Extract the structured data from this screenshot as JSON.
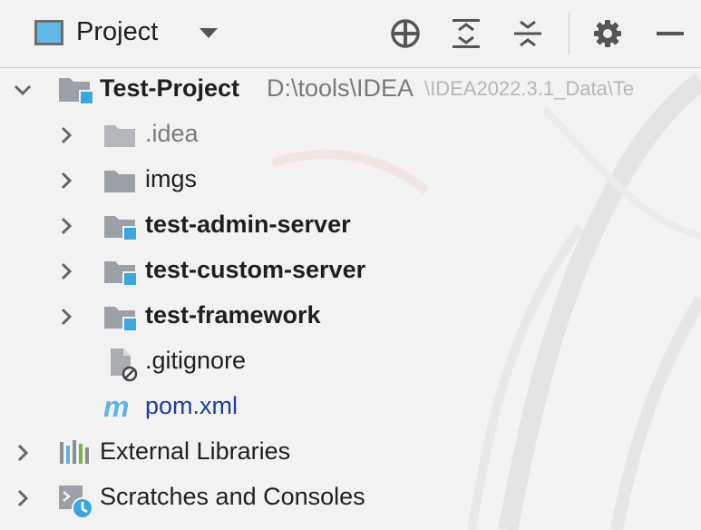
{
  "toolbar": {
    "title": "Project",
    "buttons": [
      {
        "name": "locate-icon"
      },
      {
        "name": "expand-all-icon"
      },
      {
        "name": "collapse-all-icon"
      },
      {
        "name": "gear-icon"
      },
      {
        "name": "hide-icon"
      }
    ]
  },
  "tree": {
    "root": {
      "label": "Test-Project",
      "path": "D:\\tools\\IDEA",
      "path_faded": "\\IDEA2022.3.1_Data\\Te"
    },
    "children": [
      {
        "label": ".idea",
        "type": "folder"
      },
      {
        "label": "imgs",
        "type": "folder"
      },
      {
        "label": "test-admin-server",
        "type": "module"
      },
      {
        "label": "test-custom-server",
        "type": "module"
      },
      {
        "label": "test-framework",
        "type": "module"
      },
      {
        "label": ".gitignore",
        "type": "file-ignored"
      },
      {
        "label": "pom.xml",
        "type": "maven"
      }
    ],
    "bottom": [
      {
        "label": "External Libraries"
      },
      {
        "label": "Scratches and Consoles"
      }
    ]
  },
  "colors": {
    "module_badge": "#3aa8df",
    "folder_gray": "#9aa0a6",
    "maven_blue": "#1a3e9c"
  }
}
